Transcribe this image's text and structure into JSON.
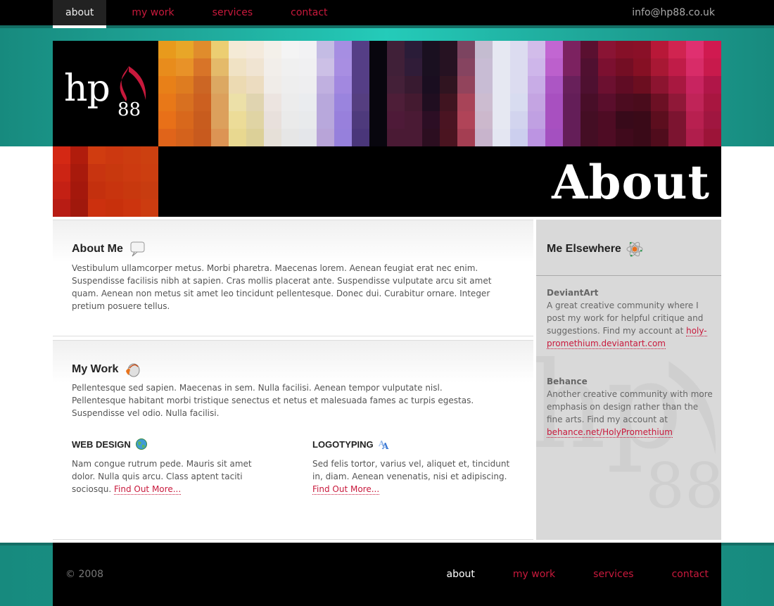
{
  "top_nav": {
    "items": [
      {
        "label": "about",
        "active": true
      },
      {
        "label": "my work",
        "active": false
      },
      {
        "label": "services",
        "active": false
      },
      {
        "label": "contact",
        "active": false
      }
    ],
    "email": "info@hp88.co.uk"
  },
  "logo": {
    "text": "hp",
    "number": "88"
  },
  "header": {
    "page_title": "About"
  },
  "colors": {
    "accent_red": "#c8193c",
    "teal": "#24cbb9",
    "sidebar_bg": "#d9d9d9"
  },
  "sections": {
    "about_me": {
      "title": "About Me",
      "icon": "speech-bubble-icon",
      "body": "Vestibulum ullamcorper metus. Morbi pharetra. Maecenas lorem. Aenean feugiat erat nec enim. Suspendisse facilisis nibh at sapien. Cras mollis placerat ante. Suspendisse vulputate arcu sit amet quam. Aenean non metus sit amet leo tincidunt pellentesque. Donec dui. Curabitur ornare. Integer pretium posuere tellus."
    },
    "my_work": {
      "title": "My Work",
      "icon": "paint-bucket-icon",
      "body": "Pellentesque sed sapien. Maecenas in sem. Nulla facilisi. Aenean tempor vulputate nisl. Pellentesque habitant morbi tristique senectus et netus et malesuada fames ac turpis egestas. Suspendisse vel odio. Nulla facilisi.",
      "web_design": {
        "title": "WEB DESIGN",
        "icon": "globe-icon",
        "body": "Nam congue rutrum pede. Mauris sit amet dolor. Nulla quis arcu. Class aptent taciti sociosqu. ",
        "link": "Find Out More..."
      },
      "logotyping": {
        "title": "LOGOTYPING",
        "icon": "font-icon",
        "body": "Sed felis tortor, varius vel, aliquet et, tincidunt in, diam. Aenean venenatis, nisi et adipiscing. ",
        "link": "Find Out More..."
      }
    }
  },
  "sidebar": {
    "title": "Me Elsewhere",
    "icon": "atom-icon",
    "entries": [
      {
        "name": "DeviantArt",
        "body": "A great creative community where I post my work for helpful critique and suggestions.  Find my account at ",
        "link": "holy-promethium.deviantart.com"
      },
      {
        "name": "Behance",
        "body": "Another creative community with more emphasis on design rather than the fine arts.  Find my account at ",
        "link": "behance.net/HolyPromethium"
      }
    ]
  },
  "footer": {
    "copyright": "© 2008",
    "nav": [
      "about",
      "my work",
      "services",
      "contact"
    ]
  }
}
